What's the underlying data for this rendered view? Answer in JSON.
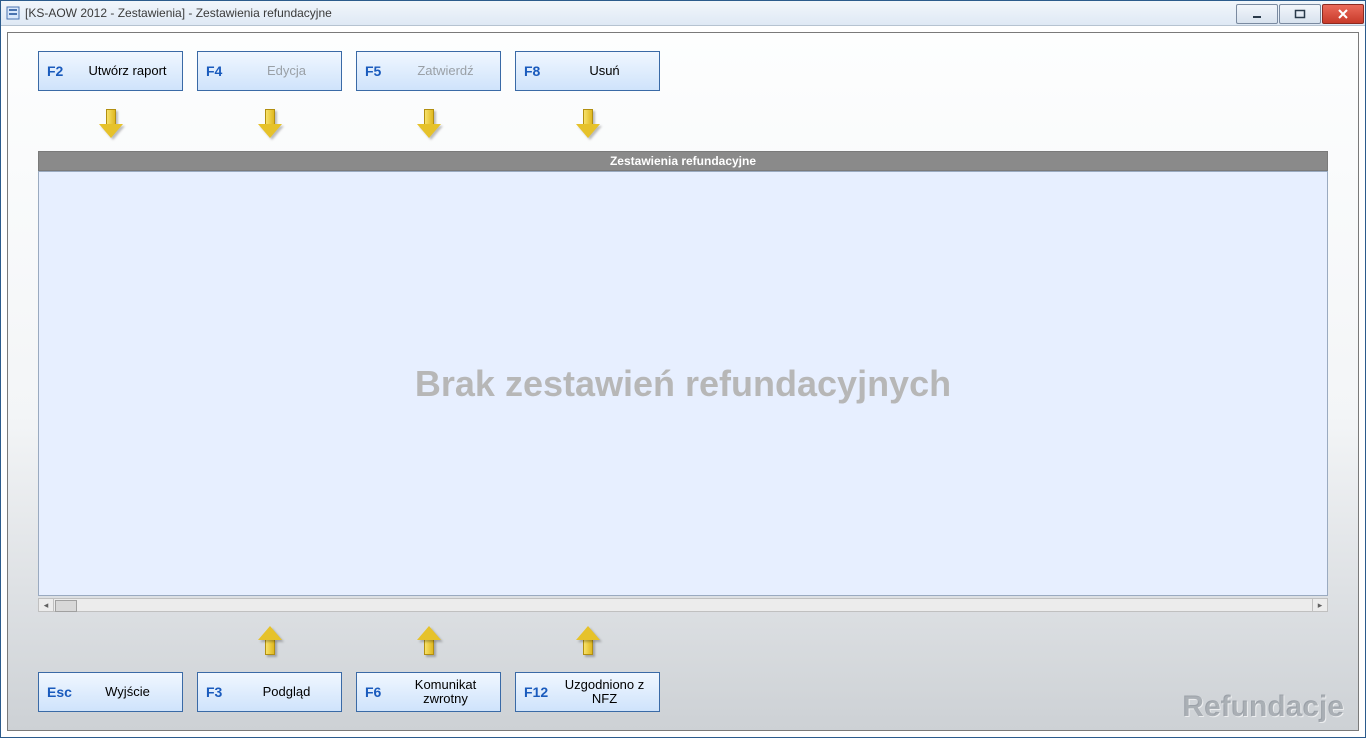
{
  "window": {
    "title": "[KS-AOW 2012 - Zestawienia] - Zestawienia refundacyjne"
  },
  "top_buttons": [
    {
      "key": "F2",
      "label": "Utwórz raport",
      "disabled": false,
      "name": "btn-create-report"
    },
    {
      "key": "F4",
      "label": "Edycja",
      "disabled": true,
      "name": "btn-edit"
    },
    {
      "key": "F5",
      "label": "Zatwierdź",
      "disabled": true,
      "name": "btn-approve"
    },
    {
      "key": "F8",
      "label": "Usuń",
      "disabled": false,
      "name": "btn-delete"
    }
  ],
  "bottom_buttons": [
    {
      "key": "Esc",
      "label": "Wyjście",
      "disabled": false,
      "name": "btn-exit"
    },
    {
      "key": "F3",
      "label": "Podgląd",
      "disabled": false,
      "name": "btn-preview"
    },
    {
      "key": "F6",
      "label": "Komunikat zwrotny",
      "disabled": false,
      "name": "btn-return-message"
    },
    {
      "key": "F12",
      "label": "Uzgodniono z NFZ",
      "disabled": false,
      "name": "btn-nfz-agreed"
    }
  ],
  "panel": {
    "header": "Zestawienia refundacyjne",
    "empty_text": "Brak zestawień refundacyjnych"
  },
  "watermark": "Refundacje"
}
